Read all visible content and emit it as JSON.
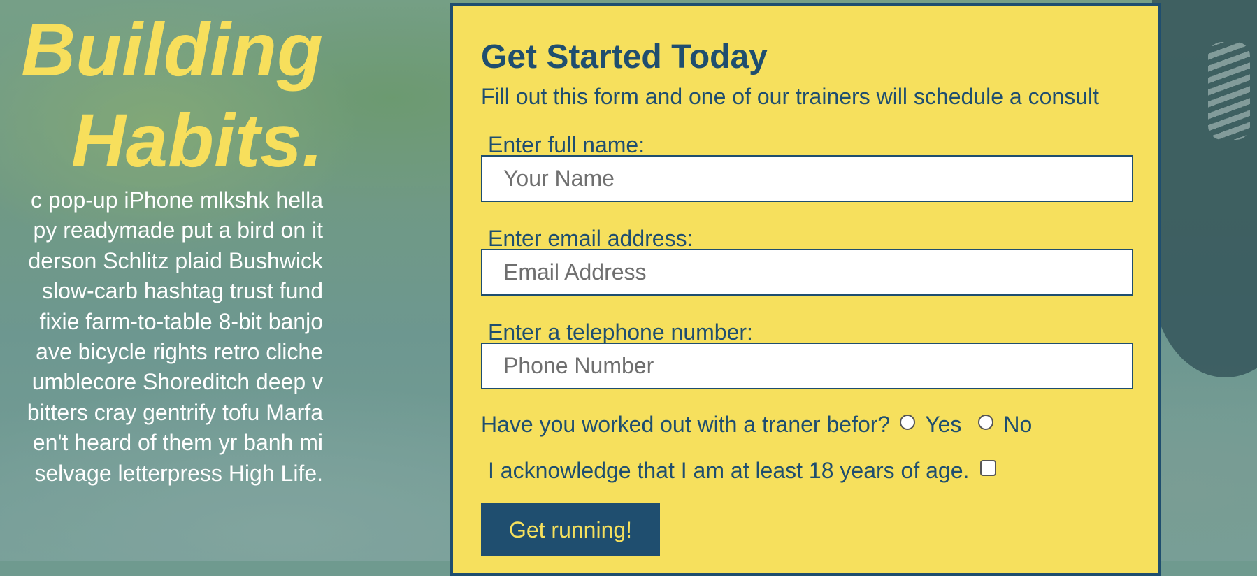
{
  "hero": {
    "title_line1": "Building",
    "title_line2": "Habits.",
    "body_lines": [
      "c pop-up iPhone mlkshk hella",
      "py readymade put a bird on it",
      "derson Schlitz plaid Bushwick",
      "slow-carb hashtag trust fund",
      "fixie farm-to-table 8-bit banjo",
      "ave bicycle rights retro cliche",
      "umblecore Shoreditch deep v",
      "bitters cray gentrify tofu Marfa",
      "en't heard of them yr banh mi",
      "selvage letterpress High Life."
    ]
  },
  "form": {
    "title": "Get Started Today",
    "subtitle": "Fill out this form and one of our trainers will schedule a consult",
    "fields": {
      "name": {
        "label": "Enter full name:",
        "placeholder": "Your Name",
        "value": ""
      },
      "email": {
        "label": "Enter email address:",
        "placeholder": "Email Address",
        "value": ""
      },
      "phone": {
        "label": "Enter a telephone number:",
        "placeholder": "Phone Number",
        "value": ""
      }
    },
    "trainer_question": "Have you worked out with a traner befor?",
    "trainer_options": [
      "Yes",
      "No"
    ],
    "age_ack": "I acknowledge that I am at least 18 years of age.",
    "submit_label": "Get running!"
  },
  "colors": {
    "accent_yellow": "#f6e05d",
    "navy": "#1f4e6f",
    "hero_title": "#f7df5c"
  }
}
